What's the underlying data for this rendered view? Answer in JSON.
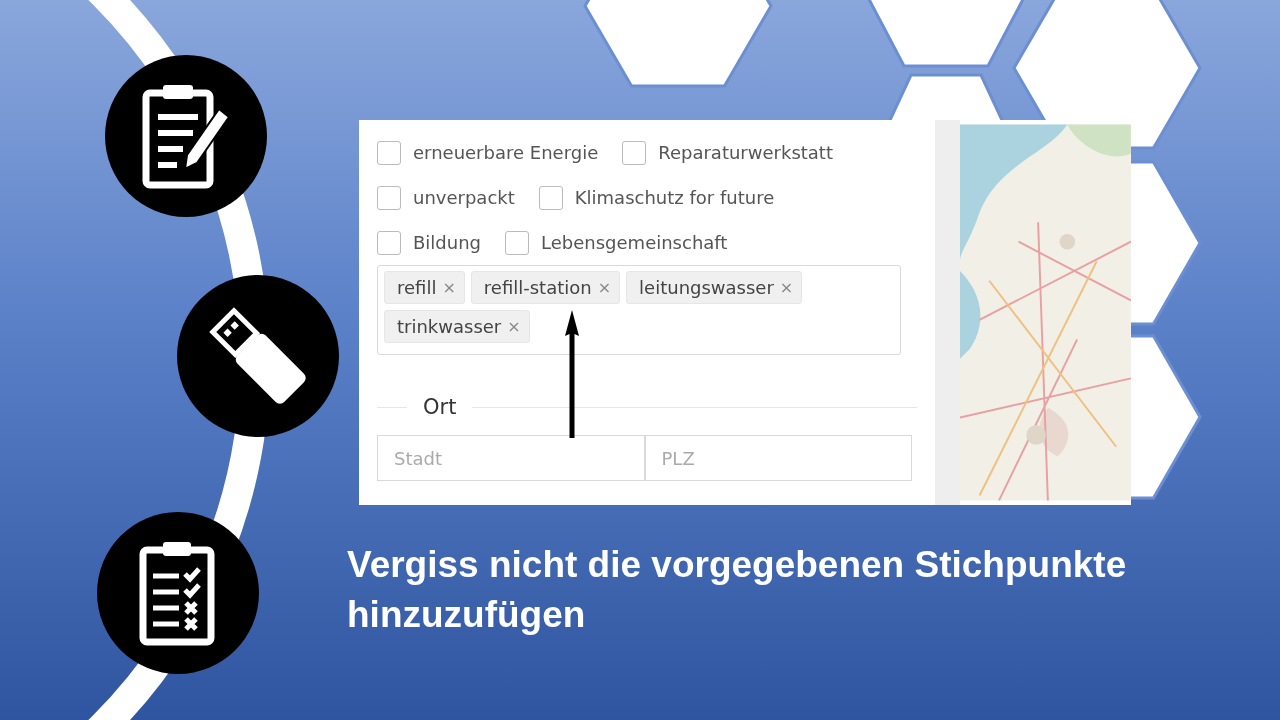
{
  "form": {
    "checkbox_rows": [
      [
        {
          "label": "erneuerbare Energie",
          "checked": false
        },
        {
          "label": "Reparaturwerkstatt",
          "checked": false
        }
      ],
      [
        {
          "label": "unverpackt",
          "checked": false
        },
        {
          "label": "Klimaschutz for future",
          "checked": false
        }
      ],
      [
        {
          "label": "Bildung",
          "checked": false
        },
        {
          "label": "Lebensgemeinschaft",
          "checked": false
        }
      ]
    ],
    "tags": [
      {
        "label": "refill",
        "remove": "×"
      },
      {
        "label": "refill-station",
        "remove": "×"
      },
      {
        "label": "leitungswasser",
        "remove": "×"
      },
      {
        "label": "trinkwasser",
        "remove": "×"
      }
    ],
    "section_title": "Ort",
    "fields": [
      {
        "placeholder": "Stadt"
      },
      {
        "placeholder": "PLZ"
      }
    ]
  },
  "caption": "Vergiss nicht die vorgegebenen Stichpunkte hinzuzufügen"
}
